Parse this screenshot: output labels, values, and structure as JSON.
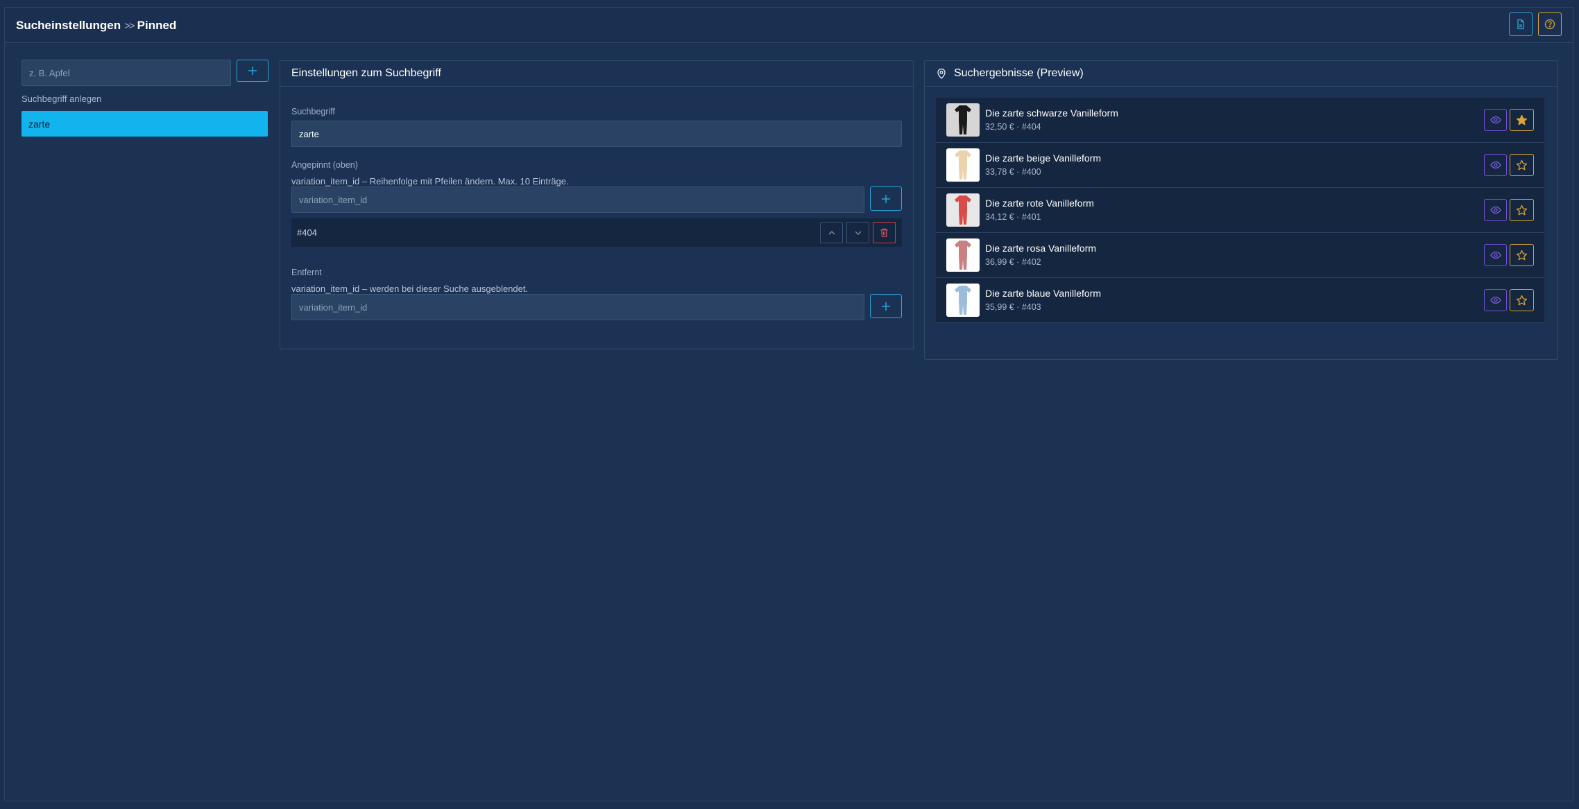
{
  "breadcrumb": {
    "root": "Sucheinstellungen",
    "separator": ">>",
    "current": "Pinned"
  },
  "terms": {
    "input_placeholder": "z. B. Apfel",
    "create_label": "Suchbegriff anlegen",
    "items": [
      {
        "label": "zarte"
      }
    ]
  },
  "settings": {
    "title": "Einstellungen zum Suchbegriff",
    "term_label": "Suchbegriff",
    "term_value": "zarte",
    "pinned_label": "Angepinnt (oben)",
    "pinned_help": "variation_item_id – Reihenfolge mit Pfeilen ändern. Max. 10 Einträge.",
    "pinned_placeholder": "variation_item_id",
    "pinned_items": [
      {
        "label": "#404"
      }
    ],
    "removed_label": "Entfernt",
    "removed_help": "variation_item_id – werden bei dieser Suche ausgeblendet.",
    "removed_placeholder": "variation_item_id"
  },
  "results": {
    "title": "Suchergebnisse (Preview)",
    "items": [
      {
        "title": "Die zarte schwarze Vanilleform",
        "meta": "32,50 € · #404",
        "color": "#1a1a1a",
        "bg": "#d6d6d6",
        "pinned": true
      },
      {
        "title": "Die zarte beige Vanilleform",
        "meta": "33,78 € · #400",
        "color": "#ead3ad",
        "bg": "#ffffff",
        "pinned": false
      },
      {
        "title": "Die zarte rote Vanilleform",
        "meta": "34,12 € · #401",
        "color": "#d94a4a",
        "bg": "#e8e8e8",
        "pinned": false
      },
      {
        "title": "Die zarte rosa Vanilleform",
        "meta": "36,99 € · #402",
        "color": "#c98080",
        "bg": "#ffffff",
        "pinned": false
      },
      {
        "title": "Die zarte blaue Vanilleform",
        "meta": "35,99 € · #403",
        "color": "#9cbcdc",
        "bg": "#ffffff",
        "pinned": false
      }
    ]
  },
  "colors": {
    "accent": "#12b4ee",
    "warning": "#d9a534",
    "violet": "#7350d4",
    "danger": "#c9444a"
  }
}
